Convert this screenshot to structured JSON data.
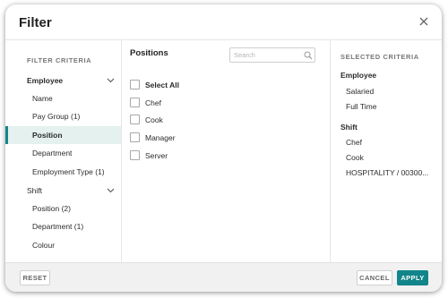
{
  "dialog": {
    "title": "Filter"
  },
  "filter_criteria": {
    "heading": "FILTER CRITERIA",
    "groups": [
      {
        "label": "Employee",
        "expanded": true,
        "items": [
          "Name",
          "Pay Group (1)",
          "Position",
          "Department",
          "Employment Type (1)"
        ],
        "active_item": "Position"
      },
      {
        "label": "Shift",
        "expanded": true,
        "items": [
          "Position (2)",
          "Department (1)",
          "Colour"
        ]
      }
    ]
  },
  "options_panel": {
    "title": "Positions",
    "search": {
      "placeholder": "Search",
      "value": ""
    },
    "options": [
      "Select All",
      "Chef",
      "Cook",
      "Manager",
      "Server"
    ]
  },
  "selected_criteria": {
    "heading": "SELECTED CRITERIA",
    "groups": [
      {
        "label": "Employee",
        "items": [
          "Salaried",
          "Full Time"
        ]
      },
      {
        "label": "Shift",
        "items": [
          "Chef",
          "Cook",
          "HOSPITALITY / 00300..."
        ]
      }
    ]
  },
  "footer": {
    "reset": "RESET",
    "cancel": "CANCEL",
    "apply": "APPLY"
  },
  "colors": {
    "accent": "#12858a",
    "active_bg": "#e4f1ef"
  },
  "icons": {
    "close": "close-icon",
    "chevron": "chevron-down-icon",
    "search": "search-icon"
  }
}
